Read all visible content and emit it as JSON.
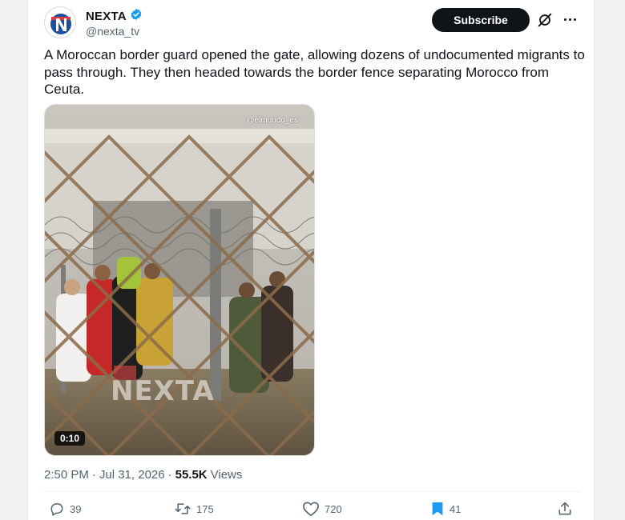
{
  "author": {
    "display_name": "NEXTA",
    "handle": "@nexta_tv",
    "avatar_icon": "nexta-logo-icon",
    "verified_icon": "verified-badge-icon"
  },
  "header": {
    "subscribe_label": "Subscribe",
    "grok_icon": "grok-icon",
    "more_icon": "more-options-icon"
  },
  "tweet": {
    "text": "A Moroccan border guard opened the gate, allowing dozens of undocumented migrants to pass through. They then headed towards the border fence separating Morocco from Ceuta."
  },
  "media": {
    "watermark": "@elmundo_es",
    "overlay_logo": "NEXTA",
    "duration": "0:10"
  },
  "meta": {
    "time": "2:50 PM",
    "separator": "·",
    "date": "Jul 31, 2026",
    "views_count": "55.5K",
    "views_label": "Views"
  },
  "actions": {
    "replies": "39",
    "reposts": "175",
    "likes": "720",
    "bookmarks": "41"
  },
  "colors": {
    "accent": "#1d9bf0",
    "text": "#0f1419",
    "secondary": "#536471",
    "brand_red": "#e03a3e"
  }
}
